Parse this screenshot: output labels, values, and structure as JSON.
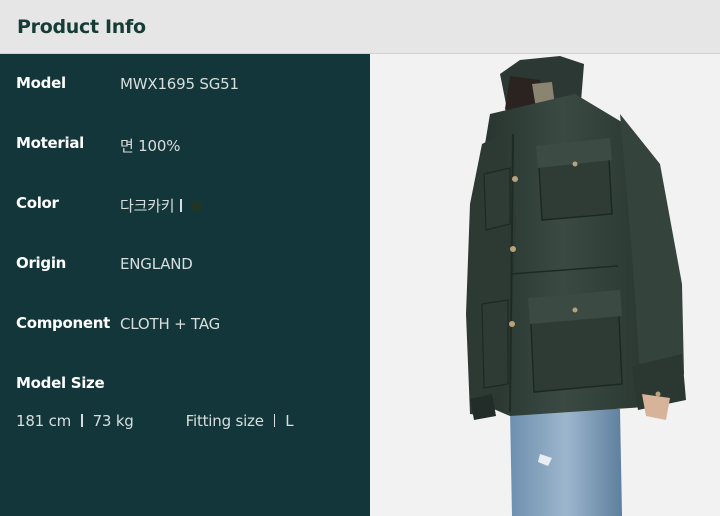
{
  "header": {
    "title": "Product Info"
  },
  "specs": {
    "model": {
      "label": "Model",
      "value": "MWX1695 SG51"
    },
    "material": {
      "label": "Moterial",
      "value": "면 100%"
    },
    "color": {
      "label": "Color",
      "value": "다크카키",
      "swatch": "#1f3526"
    },
    "origin": {
      "label": "Origin",
      "value": "ENGLAND"
    },
    "component": {
      "label": "Component",
      "value": "CLOTH + TAG"
    },
    "model_size": {
      "label": "Model Size",
      "height": "181 cm",
      "weight": "73 kg",
      "fitting_label": "Fitting size",
      "fitting_value": "L"
    }
  },
  "colors": {
    "panel": "#12363a",
    "header_bg": "#e6e6e6",
    "header_text": "#163c36",
    "jacket": "#2f3d37"
  }
}
